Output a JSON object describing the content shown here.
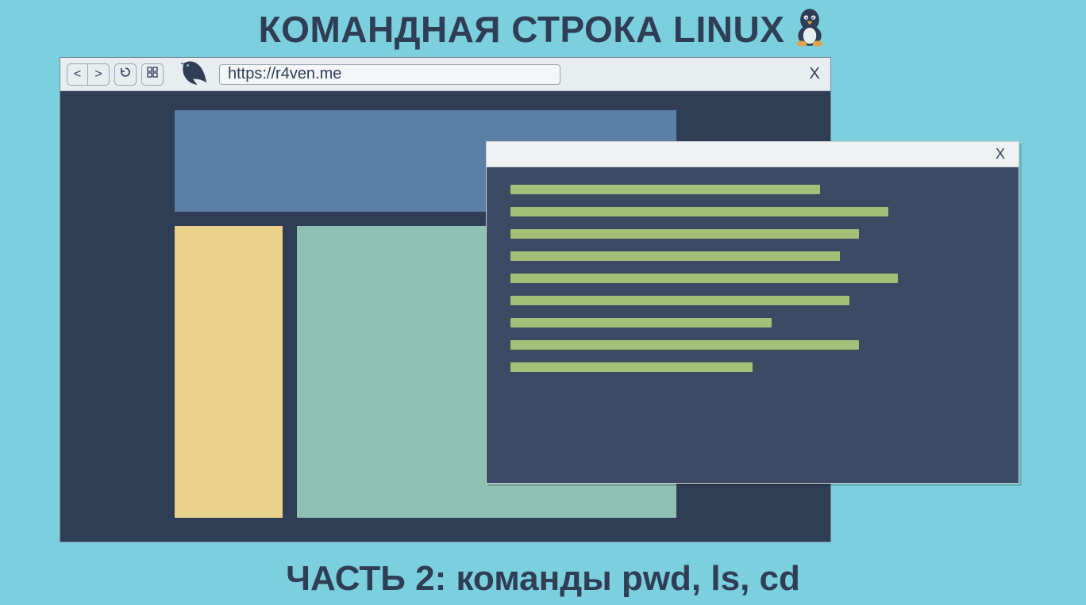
{
  "header": {
    "title": "КОМАНДНАЯ СТРОКА LINUX"
  },
  "footer": {
    "subtitle": "ЧАСТЬ 2: команды pwd, ls, cd"
  },
  "browser": {
    "back_label": "<",
    "forward_label": ">",
    "reload_label": "⟳",
    "extra_label": "⊞",
    "address_value": "https://r4ven.me",
    "close_label": "X"
  },
  "terminal": {
    "close_label": "X",
    "line_widths_pct": [
      64,
      78,
      72,
      68,
      80,
      70,
      54,
      72,
      50
    ]
  },
  "colors": {
    "bg": "#7cd0de",
    "dark": "#2f3e55",
    "terminal_bg": "#3c4a63",
    "term_line": "#a3c078",
    "hero": "#5b7fa5",
    "side": "#ead18c",
    "main_block": "#8fc0b4"
  }
}
